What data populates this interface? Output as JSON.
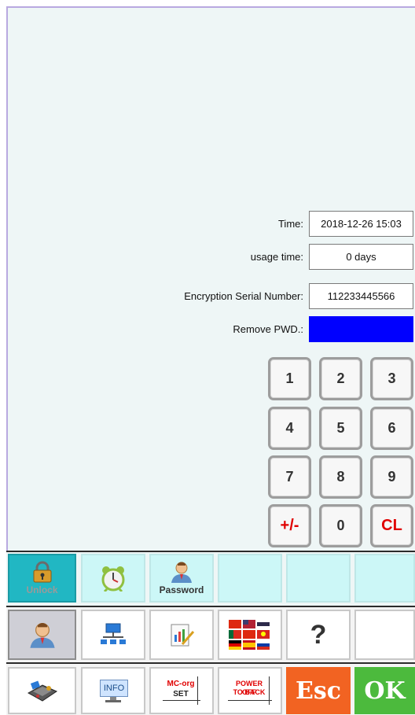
{
  "fields": [
    {
      "label": "Time:",
      "value": "2018-12-26 15:03"
    },
    {
      "label": "usage time:",
      "value": "0 days"
    },
    {
      "label": "Encryption Serial Number:",
      "value": "112233445566"
    },
    {
      "label": "Remove PWD.:",
      "value": ""
    }
  ],
  "keypad": [
    "1",
    "2",
    "3",
    "4",
    "5",
    "6",
    "7",
    "8",
    "9",
    "+/-",
    "0",
    "CL"
  ],
  "toolbar1": {
    "unlock": "Unlock",
    "password": "Password"
  },
  "toolbar3": {
    "info": "INFO",
    "mc_org_top": "MC-org",
    "mc_org_bottom": "SET",
    "power_top": "POWER OFF",
    "power_bottom": "TO BACK",
    "esc": "Esc",
    "ok": "OK"
  },
  "toolbar2": {
    "help": "?"
  },
  "colors": {
    "accent": "#21b7c3",
    "password_box": "#0000ff",
    "esc": "#f26322",
    "ok": "#4cba3d"
  }
}
